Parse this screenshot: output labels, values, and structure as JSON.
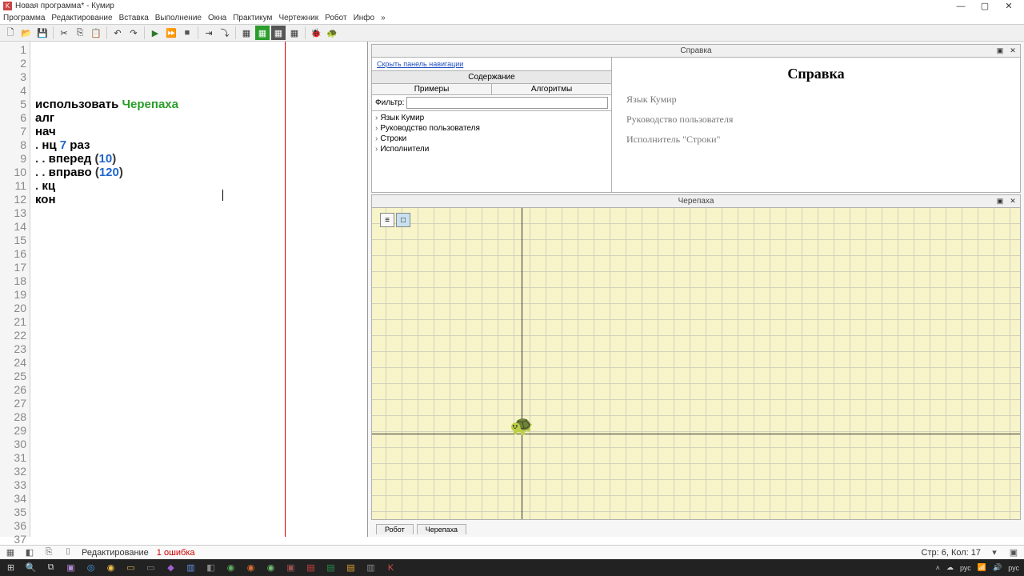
{
  "title": "Новая программа* - Кумир",
  "menu": [
    "Программа",
    "Редактирование",
    "Вставка",
    "Выполнение",
    "Окна",
    "Практикум",
    "Чертежник",
    "Робот",
    "Инфо",
    "»"
  ],
  "toolbar_icons": [
    "new",
    "open",
    "save",
    "|",
    "cut",
    "copy",
    "paste",
    "|",
    "undo",
    "redo",
    "|",
    "run",
    "run-fast",
    "stop",
    "|",
    "step",
    "step-into",
    "|",
    "grid-large",
    "grid-green",
    "grid-dark",
    "grid-small",
    "|",
    "actor1",
    "actor2"
  ],
  "code_lines": 37,
  "code": [
    {
      "t": [
        {
          "c": "kw",
          "s": "использовать "
        },
        {
          "c": "hl-green",
          "s": "Черепаха"
        }
      ]
    },
    {
      "t": [
        {
          "c": "kw",
          "s": "алг"
        }
      ]
    },
    {
      "t": [
        {
          "c": "kw",
          "s": "нач"
        }
      ]
    },
    {
      "t": [
        {
          "c": "",
          "s": ". "
        },
        {
          "c": "kw",
          "s": "нц "
        },
        {
          "c": "num",
          "s": "7"
        },
        {
          "c": "kw",
          "s": " раз"
        }
      ]
    },
    {
      "t": [
        {
          "c": "",
          "s": ". . "
        },
        {
          "c": "kw",
          "s": "вперед"
        },
        {
          "c": "",
          "s": " ("
        },
        {
          "c": "num",
          "s": "10"
        },
        {
          "c": "",
          "s": ")"
        }
      ]
    },
    {
      "t": [
        {
          "c": "",
          "s": ". . "
        },
        {
          "c": "kw",
          "s": "вправо"
        },
        {
          "c": "",
          "s": " ("
        },
        {
          "c": "num",
          "s": "120"
        },
        {
          "c": "",
          "s": ")"
        }
      ]
    },
    {
      "t": [
        {
          "c": "",
          "s": ". "
        },
        {
          "c": "kw",
          "s": "кц"
        }
      ]
    },
    {
      "t": [
        {
          "c": "kw",
          "s": "кон"
        }
      ]
    }
  ],
  "help": {
    "panel_title": "Справка",
    "hide_link": "Скрыть панель навигации",
    "tabs1": [
      "Содержание"
    ],
    "tabs2": [
      "Примеры",
      "Алгоритмы"
    ],
    "filter_label": "Фильтр:",
    "toc": [
      "Язык Кумир",
      "Руководство пользователя",
      "Строки",
      "Исполнители"
    ],
    "heading": "Справка",
    "links": [
      "Язык Кумир",
      "Руководство пользователя",
      "Исполнитель \"Строки\""
    ]
  },
  "turtle": {
    "panel_title": "Черепаха"
  },
  "right_tabs": [
    "Робот",
    "Черепаха"
  ],
  "status": {
    "mode": "Редактирование",
    "error": "1 ошибка",
    "pos": "Стр: 6, Кол: 17"
  },
  "tray": {
    "lang": "рус"
  }
}
